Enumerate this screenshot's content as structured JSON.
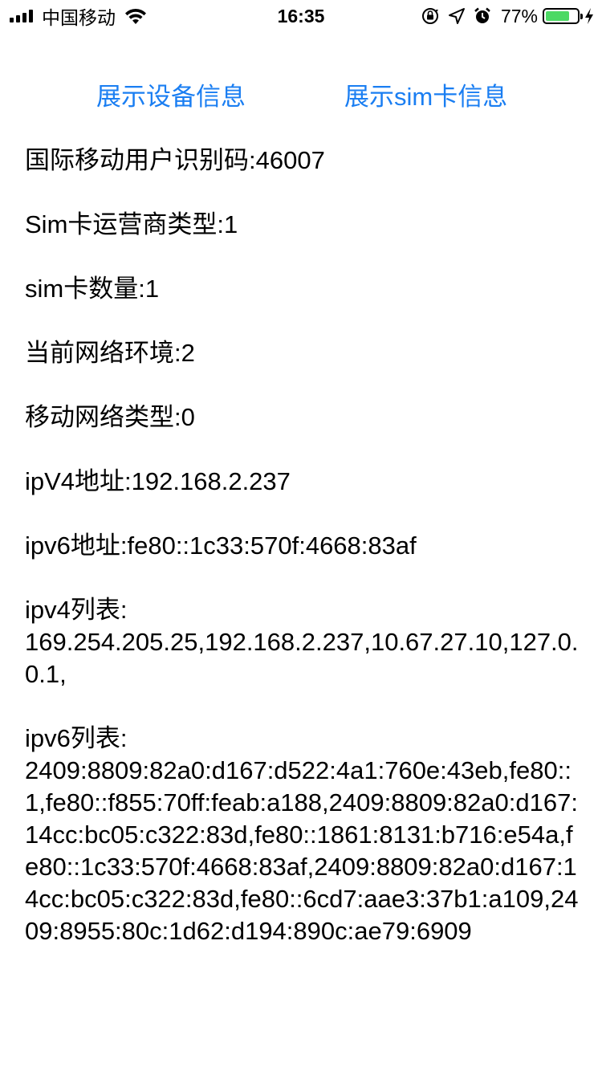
{
  "status_bar": {
    "carrier": "中国移动",
    "time": "16:35",
    "battery_percent": "77%",
    "battery_level": 0.77,
    "icons": [
      "signal-icon",
      "wifi-icon",
      "rotation-lock-icon",
      "location-icon",
      "alarm-icon",
      "battery-icon",
      "charging-icon"
    ],
    "battery_color": "#4cd964"
  },
  "tabs": {
    "device_info": "展示设备信息",
    "sim_info": "展示sim卡信息",
    "accent_color": "#1a7ef2"
  },
  "info": {
    "imsi": "国际移动用户识别码:46007",
    "carrier_type": "Sim卡运营商类型:1",
    "sim_count": "sim卡数量:1",
    "network_env": "当前网络环境:2",
    "mobile_network_type": "移动网络类型:0",
    "ipv4_address": "ipV4地址:192.168.2.237",
    "ipv6_address": "ipv6地址:fe80::1c33:570f:4668:83af",
    "ipv4_list_label": "ipv4列表:",
    "ipv4_list": "169.254.205.25,192.168.2.237,10.67.27.10,127.0.0.1,",
    "ipv6_list_label": "ipv6列表:",
    "ipv6_list": "2409:8809:82a0:d167:d522:4a1:760e:43eb,fe80::1,fe80::f855:70ff:feab:a188,2409:8809:82a0:d167:14cc:bc05:c322:83d,fe80::1861:8131:b716:e54a,fe80::1c33:570f:4668:83af,2409:8809:82a0:d167:14cc:bc05:c322:83d,fe80::6cd7:aae3:37b1:a109,2409:8955:80c:1d62:d194:890c:ae79:6909"
  }
}
